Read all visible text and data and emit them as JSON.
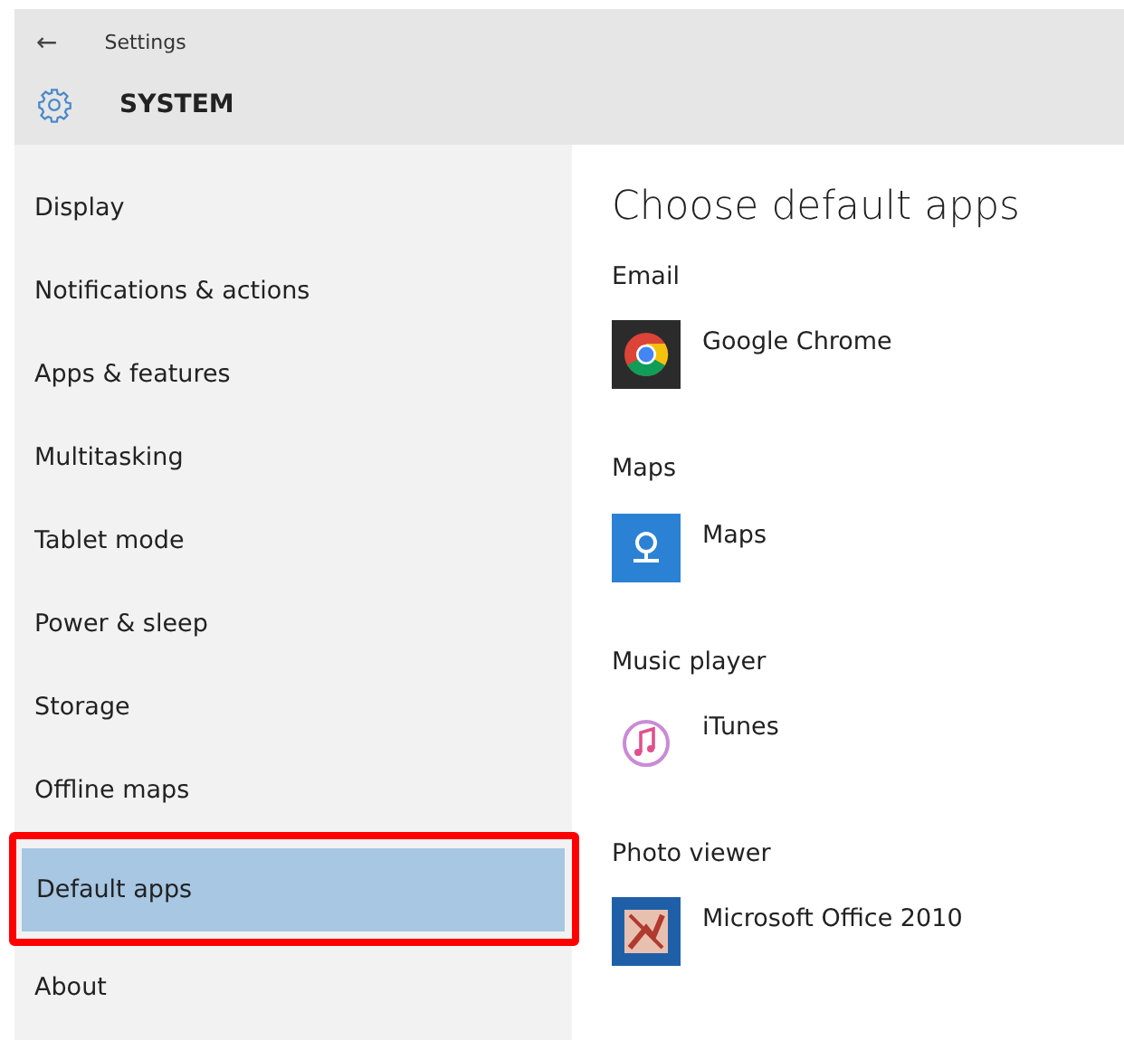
{
  "header": {
    "back": "←",
    "title": "Settings",
    "section": "SYSTEM"
  },
  "sidebar": {
    "items": [
      {
        "label": "Display",
        "selected": false,
        "outlined": false
      },
      {
        "label": "Notifications & actions",
        "selected": false,
        "outlined": false
      },
      {
        "label": "Apps & features",
        "selected": false,
        "outlined": false
      },
      {
        "label": "Multitasking",
        "selected": false,
        "outlined": false
      },
      {
        "label": "Tablet mode",
        "selected": false,
        "outlined": false
      },
      {
        "label": "Power & sleep",
        "selected": false,
        "outlined": false
      },
      {
        "label": "Storage",
        "selected": false,
        "outlined": false
      },
      {
        "label": "Offline maps",
        "selected": false,
        "outlined": false
      },
      {
        "label": "Default apps",
        "selected": true,
        "outlined": true
      },
      {
        "label": "About",
        "selected": false,
        "outlined": false
      }
    ]
  },
  "content": {
    "heading": "Choose default apps",
    "sections": [
      {
        "label": "Email",
        "app": {
          "name": "Google Chrome",
          "kind": "chrome"
        }
      },
      {
        "label": "Maps",
        "app": {
          "name": "Maps",
          "kind": "maps"
        }
      },
      {
        "label": "Music player",
        "app": {
          "name": "iTunes",
          "kind": "music"
        }
      },
      {
        "label": "Photo viewer",
        "app": {
          "name": "Microsoft Office 2010",
          "kind": "photo"
        }
      }
    ]
  }
}
